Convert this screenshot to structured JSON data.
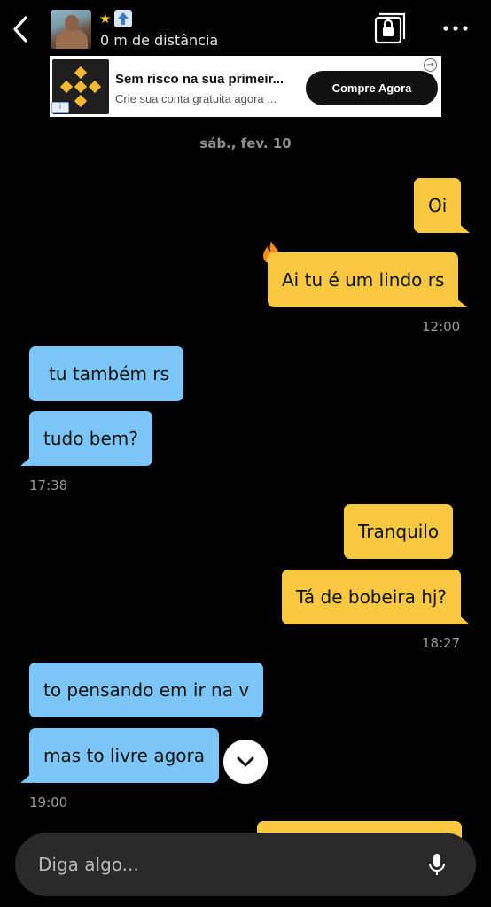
{
  "header": {
    "distance": "0 m de distância",
    "star_icon": "star-icon",
    "boost_icon": "up-arrow-icon"
  },
  "ad": {
    "title": "Sem risco na sua primeir...",
    "subtitle": "Crie sua conta gratuita agora ...",
    "cta": "Compre Agora",
    "info": "i"
  },
  "chat": {
    "date": "sáb., fev. 10",
    "messages": [
      {
        "text": "Oi",
        "side": "out"
      },
      {
        "text": "Ai tu é um lindo rs",
        "side": "out",
        "reaction": "fire"
      },
      {
        "text": "tu também rs",
        "side": "in"
      },
      {
        "text": "tudo bem?",
        "side": "in"
      },
      {
        "text": "Tranquilo",
        "side": "out"
      },
      {
        "text": "Tá de bobeira hj?",
        "side": "out"
      },
      {
        "text": "to pensando em ir na v",
        "side": "in"
      },
      {
        "text": "mas to livre agora",
        "side": "in"
      }
    ],
    "times": [
      "12:00",
      "17:38",
      "18:27",
      "19:00"
    ]
  },
  "composer": {
    "placeholder": "Diga algo..."
  },
  "colors": {
    "outgoing": "#f8c93e",
    "incoming": "#7cc6f7",
    "background": "#000000"
  }
}
